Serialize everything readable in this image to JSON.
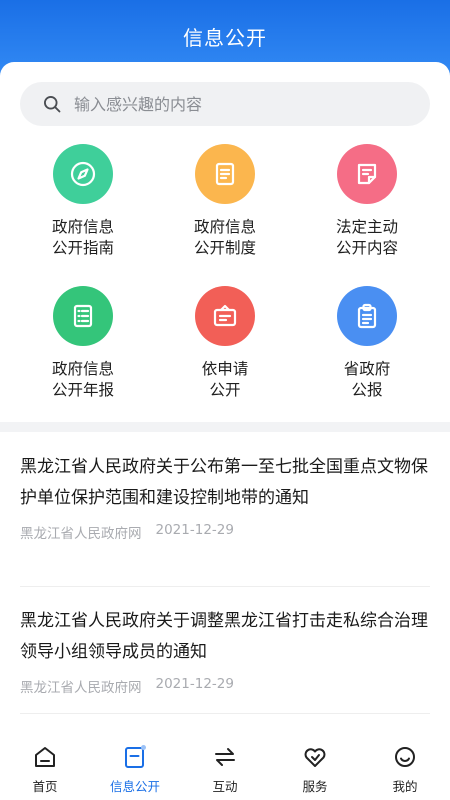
{
  "header": {
    "title": "信息公开"
  },
  "search": {
    "placeholder": "输入感兴趣的内容"
  },
  "grid": [
    {
      "label": "政府信息\n公开指南",
      "color": "#3fcf9a",
      "icon": "compass-icon"
    },
    {
      "label": "政府信息\n公开制度",
      "color": "#fbb64e",
      "icon": "document-icon"
    },
    {
      "label": "法定主动\n公开内容",
      "color": "#f56d86",
      "icon": "note-icon"
    },
    {
      "label": "政府信息\n公开年报",
      "color": "#34c57a",
      "icon": "list-icon"
    },
    {
      "label": "依申请\n公开",
      "color": "#f25f57",
      "icon": "inbox-icon"
    },
    {
      "label": "省政府\n公报",
      "color": "#4a8ff2",
      "icon": "clipboard-icon"
    }
  ],
  "news": [
    {
      "title": "黑龙江省人民政府关于公布第一至七批全国重点文物保护单位保护范围和建设控制地带的通知",
      "source": "黑龙江省人民政府网",
      "date": "2021-12-29"
    },
    {
      "title": "黑龙江省人民政府关于调整黑龙江省打击走私综合治理领导小组领导成员的通知",
      "source": "黑龙江省人民政府网",
      "date": "2021-12-29"
    }
  ],
  "tabs": [
    {
      "label": "首页",
      "icon": "home-icon",
      "active": false
    },
    {
      "label": "信息公开",
      "icon": "info-disclosure-icon",
      "active": true
    },
    {
      "label": "互动",
      "icon": "interaction-icon",
      "active": false
    },
    {
      "label": "服务",
      "icon": "heart-icon",
      "active": false
    },
    {
      "label": "我的",
      "icon": "profile-icon",
      "active": false
    }
  ],
  "colors": {
    "accent": "#1a6fe6"
  }
}
